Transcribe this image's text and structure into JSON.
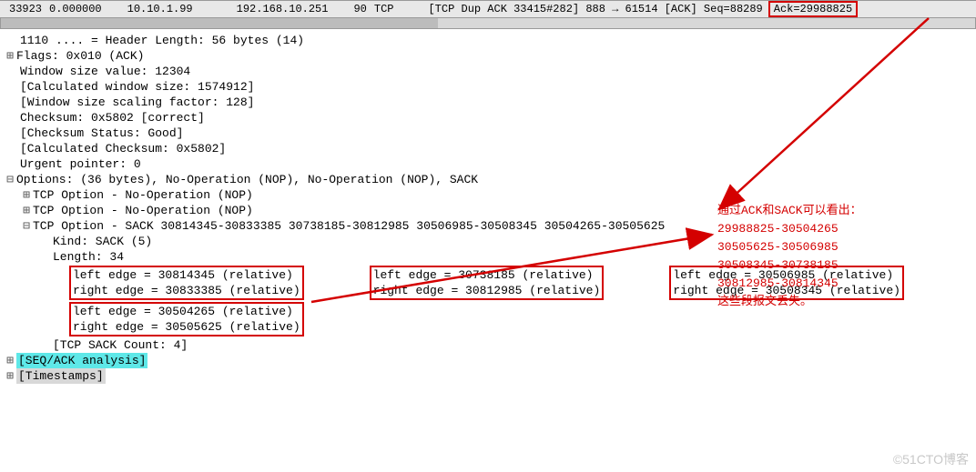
{
  "packet_row": {
    "num": "33923",
    "time": "0.000000",
    "src": "10.10.1.99",
    "dst": "192.168.10.251",
    "len": "90",
    "proto": "TCP",
    "info": "[TCP Dup ACK 33415#282] 888 → 61514 [ACK] Seq=88289",
    "ack": "Ack=29988825"
  },
  "tree": {
    "hdr_len": "1110 .... = Header Length: 56 bytes (14)",
    "flags": "Flags: 0x010 (ACK)",
    "win_val": "Window size value: 12304",
    "win_calc": "[Calculated window size: 1574912]",
    "win_scale": "[Window size scaling factor: 128]",
    "cksum": "Checksum: 0x5802 [correct]",
    "cksum_status": "[Checksum Status: Good]",
    "cksum_calc": "[Calculated Checksum: 0x5802]",
    "urg": "Urgent pointer: 0",
    "options": "Options: (36 bytes), No-Operation (NOP), No-Operation (NOP), SACK",
    "nop1": "TCP Option - No-Operation (NOP)",
    "nop2": "TCP Option - No-Operation (NOP)",
    "sack_hdr": "TCP Option - SACK 30814345-30833385 30738185-30812985 30506985-30508345 30504265-30505625",
    "kind": "Kind: SACK (5)",
    "length": "Length: 34",
    "edges": [
      {
        "left": "left edge = 30814345 (relative)",
        "right": "right edge = 30833385 (relative)"
      },
      {
        "left": "left edge = 30738185 (relative)",
        "right": "right edge = 30812985 (relative)"
      },
      {
        "left": "left edge = 30506985 (relative)",
        "right": "right edge = 30508345 (relative)"
      },
      {
        "left": "left edge = 30504265 (relative)",
        "right": "right edge = 30505625 (relative)"
      }
    ],
    "sack_count": "[TCP SACK Count: 4]",
    "seqack": "[SEQ/ACK analysis]",
    "timestamps": "[Timestamps]"
  },
  "annotation": {
    "l1": "通过ACK和SACK可以看出：",
    "l2": "29988825-30504265",
    "l3": "30505625-30506985",
    "l4": "30508345-30738185",
    "l5": "30812985-30814345",
    "l6": "这些段报文丢失。"
  },
  "watermark": "©51CTO博客"
}
